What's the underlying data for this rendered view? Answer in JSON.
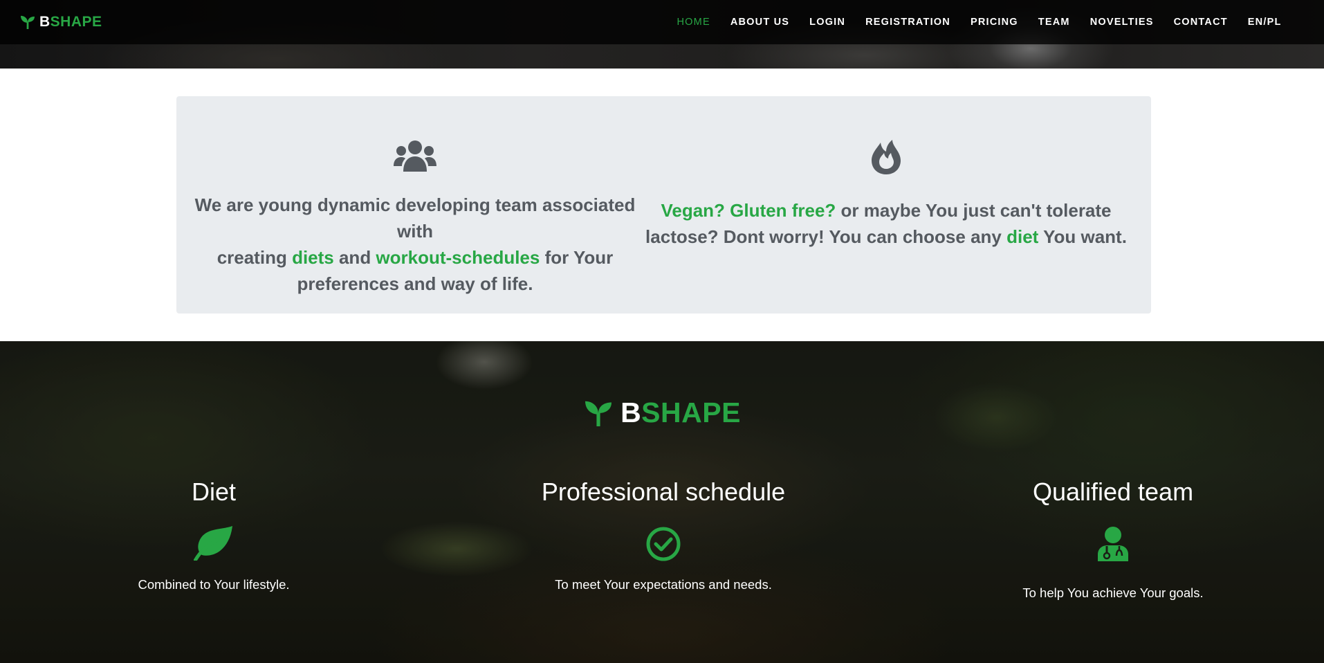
{
  "brand": {
    "first_letter": "B",
    "rest": "SHAPE"
  },
  "nav": {
    "items": [
      {
        "label": "HOME",
        "active": true
      },
      {
        "label": "ABOUT US"
      },
      {
        "label": "LOGIN"
      },
      {
        "label": "REGISTRATION"
      },
      {
        "label": "PRICING"
      },
      {
        "label": "TEAM"
      },
      {
        "label": "NOVELTIES"
      },
      {
        "label": "CONTACT"
      },
      {
        "label": "EN/PL"
      }
    ]
  },
  "about": {
    "left": {
      "icon": "users-icon",
      "line1": "We are young dynamic developing team associated with",
      "line2_pre": "creating ",
      "line2_hl1": "diets",
      "line2_mid": " and ",
      "line2_hl2": "workout-schedules",
      "line2_post": " for Your",
      "line3": "preferences and way of life."
    },
    "right": {
      "icon": "fire-icon",
      "line1_hl": "Vegan? Gluten free?",
      "line1_post": " or maybe You just can't tolerate",
      "line2_pre": "lactose? Dont worry! You can choose any ",
      "line2_hl": "diet",
      "line2_post": " You want."
    }
  },
  "features": {
    "items": [
      {
        "title": "Diet",
        "icon": "leaf-icon",
        "desc": "Combined to Your lifestyle."
      },
      {
        "title": "Professional schedule",
        "icon": "check-circle-icon",
        "desc": "To meet Your expectations and needs."
      },
      {
        "title": "Qualified team",
        "icon": "user-doctor-icon",
        "desc": "To help You achieve Your goals."
      }
    ]
  },
  "colors": {
    "accent": "#28a745",
    "text_gray": "#555a60",
    "card_bg": "#e9ecef"
  }
}
